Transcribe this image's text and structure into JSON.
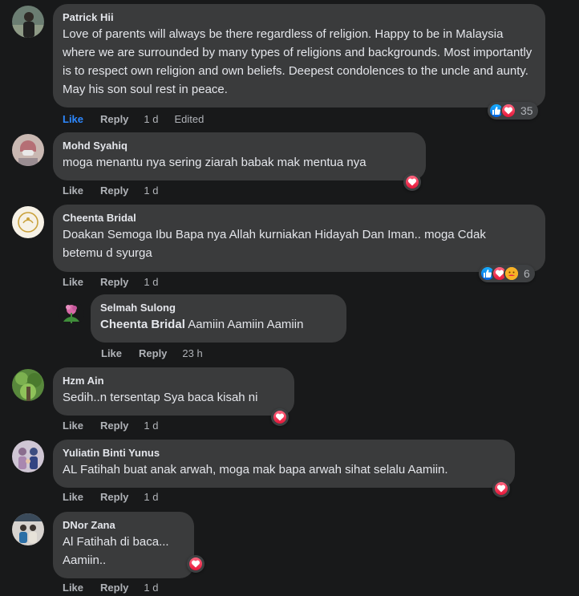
{
  "actions": {
    "like": "Like",
    "reply": "Reply"
  },
  "comments": [
    {
      "author": "Patrick Hii",
      "text": "Love of parents will always be there regardless of religion. Happy to be in Malaysia where we are surrounded by many types of religions and backgrounds. Most importantly is to respect own religion and own beliefs. Deepest condolences to the uncle and aunty. May his son soul rest in peace.",
      "time": "1 d",
      "edited": "Edited",
      "liked": true,
      "reactions": [
        "like-icon",
        "love-icon"
      ],
      "reaction_count": "35"
    },
    {
      "author": "Mohd Syahiq",
      "text": "moga menantu nya sering ziarah babak mak mentua nya",
      "time": "1 d",
      "reactions": [
        "love-icon"
      ]
    },
    {
      "author": "Cheenta Bridal",
      "text": "Doakan Semoga Ibu Bapa nya Allah kurniakan Hidayah Dan Iman.. moga Cdak betemu d syurga",
      "time": "1 d",
      "reactions": [
        "like-icon",
        "love-icon",
        "care-icon"
      ],
      "reaction_count": "6"
    },
    {
      "author": "Selmah Sulong",
      "tag": "Cheenta Bridal",
      "text": "Aamiin Aamiin Aamiin",
      "time": "23 h",
      "reply": true
    },
    {
      "author": "Hzm Ain",
      "text": "Sedih..n tersentap Sya baca kisah ni",
      "time": "1 d",
      "reactions": [
        "love-icon"
      ]
    },
    {
      "author": "Yuliatin Binti Yunus",
      "text": "AL Fatihah buat anak arwah, moga mak bapa arwah sihat selalu Aamiin.",
      "time": "1 d",
      "reactions": [
        "love-icon"
      ]
    },
    {
      "author": "DNor Zana",
      "text_lines": [
        "Al Fatihah di baca...",
        "Aamiin.."
      ],
      "time": "1 d",
      "reactions": [
        "love-icon"
      ]
    }
  ],
  "colors": {
    "background": "#18191a",
    "bubble": "#3a3b3c",
    "text": "#e4e6eb",
    "secondary_text": "#b0b3b8",
    "like_active": "#2d88ff",
    "like_reaction": "#0a7cff",
    "love_reaction": "#f33e58",
    "care_reaction": "#f7b125"
  }
}
